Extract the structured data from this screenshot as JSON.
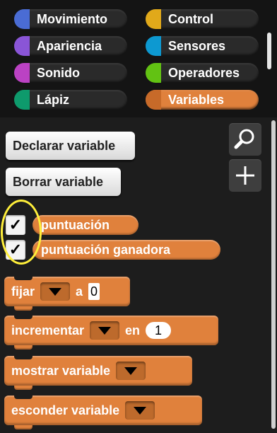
{
  "categories": [
    {
      "label": "Movimiento",
      "color": "#4a6cd4",
      "active": false
    },
    {
      "label": "Control",
      "color": "#e1a91a",
      "active": false
    },
    {
      "label": "Apariencia",
      "color": "#8a55d7",
      "active": false
    },
    {
      "label": "Sensores",
      "color": "#0d99d1",
      "active": false
    },
    {
      "label": "Sonido",
      "color": "#bb42c3",
      "active": false
    },
    {
      "label": "Operadores",
      "color": "#62c213",
      "active": false
    },
    {
      "label": "Lápiz",
      "color": "#0e9a6c",
      "active": false
    },
    {
      "label": "Variables",
      "color": "#e0813c",
      "active": true
    }
  ],
  "palette": {
    "declare_button": "Declarar variable",
    "delete_button": "Borrar variable",
    "search_icon": "search-icon",
    "add_icon": "plus-icon",
    "variables": [
      {
        "name": "puntuación",
        "checked": true,
        "check_glyph": "✓"
      },
      {
        "name": "puntuación ganadora",
        "checked": true,
        "check_glyph": "✓"
      }
    ],
    "blocks": {
      "set": {
        "label": "fijar",
        "to_label": "a",
        "value": "0"
      },
      "change": {
        "label": "incrementar",
        "by_label": "en",
        "value": "1"
      },
      "show": {
        "label": "mostrar variable"
      },
      "hide": {
        "label": "esconder variable"
      }
    }
  },
  "colors": {
    "variables": "#e0813c",
    "highlight": "#ffef3a"
  }
}
